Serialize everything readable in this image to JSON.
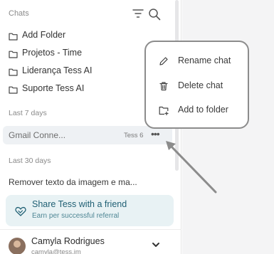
{
  "sidebar": {
    "header": {
      "title": "Chats"
    },
    "folders": [
      {
        "label": "Add Folder"
      },
      {
        "label": "Projetos - Time"
      },
      {
        "label": "Liderança Tess AI"
      },
      {
        "label": "Suporte Tess AI"
      }
    ],
    "sections": {
      "last7": "Last 7 days",
      "last30": "Last 30 days"
    },
    "chats_recent": [
      {
        "title": "Gmail Conne...",
        "badge": "Tess 6",
        "more": "•••"
      }
    ],
    "chats_older": [
      {
        "title": "Remover texto da imagem e ma..."
      }
    ],
    "share": {
      "title": "Share Tess with a friend",
      "subtitle": "Earn per successful referral"
    },
    "user": {
      "name": "Camyla Rodrigues",
      "email": "camyla@tess.im"
    }
  },
  "context_menu": {
    "items": [
      {
        "label": "Rename chat",
        "icon": "pencil-icon"
      },
      {
        "label": "Delete chat",
        "icon": "trash-icon"
      },
      {
        "label": "Add to folder",
        "icon": "folder-plus-icon"
      }
    ]
  },
  "colors": {
    "accent_bg": "#e8f2f4",
    "accent_text": "#1f5f73",
    "menu_border": "#8c8c8c",
    "arrow": "#8c8c8c"
  }
}
